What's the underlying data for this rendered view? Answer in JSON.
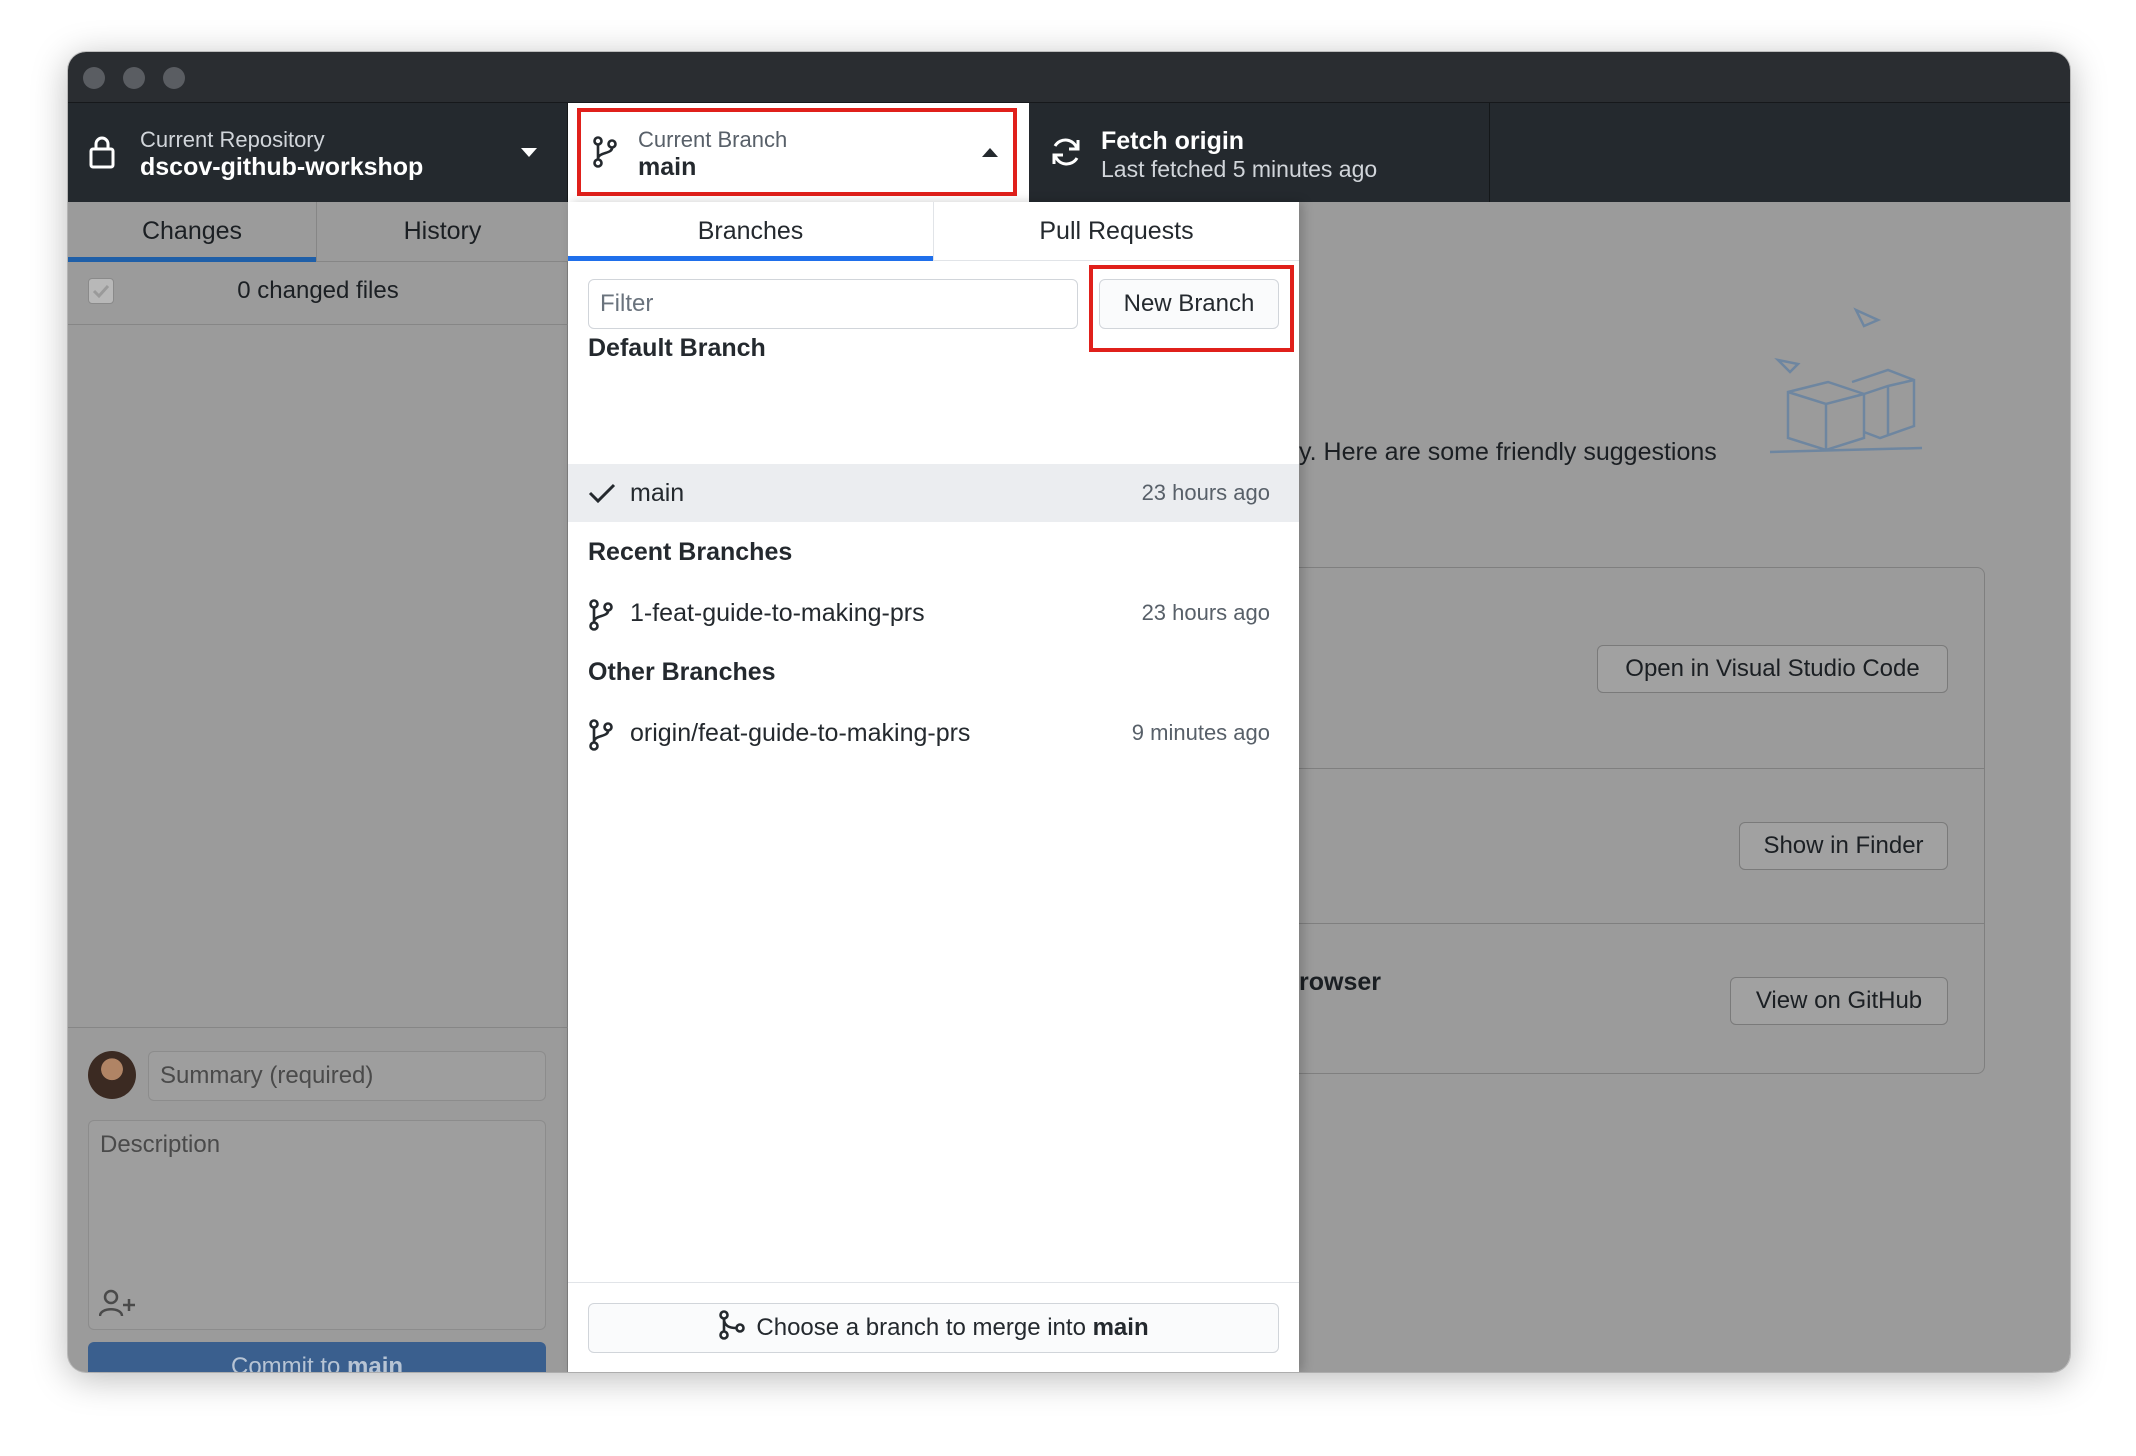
{
  "toolbar": {
    "repo_label": "Current Repository",
    "repo_name": "dscov-github-workshop",
    "branch_label": "Current Branch",
    "branch_name": "main",
    "fetch_title": "Fetch origin",
    "fetch_subtitle": "Last fetched 5 minutes ago"
  },
  "sidebar": {
    "tabs": [
      {
        "label": "Changes",
        "selected": true
      },
      {
        "label": "History",
        "selected": false
      }
    ],
    "changed_files": "0 changed files",
    "summary_placeholder": "Summary (required)",
    "description_placeholder": "Description",
    "commit_prefix": "Commit to ",
    "commit_branch": "main"
  },
  "branch_dropdown": {
    "tabs": [
      {
        "label": "Branches",
        "selected": true
      },
      {
        "label": "Pull Requests",
        "selected": false
      }
    ],
    "filter_placeholder": "Filter",
    "new_branch_label": "New Branch",
    "groups": [
      {
        "header": "Default Branch",
        "branches": [
          {
            "name": "main",
            "time": "23 hours ago",
            "current": true
          }
        ]
      },
      {
        "header": "Recent Branches",
        "branches": [
          {
            "name": "1-feat-guide-to-making-prs",
            "time": "23 hours ago",
            "current": false
          }
        ]
      },
      {
        "header": "Other Branches",
        "branches": [
          {
            "name": "origin/feat-guide-to-making-prs",
            "time": "9 minutes ago",
            "current": false
          }
        ]
      }
    ],
    "merge_prefix": "Choose a branch to merge into ",
    "merge_branch": "main"
  },
  "main_content": {
    "suggestion_fragment": "y. Here are some friendly suggestions",
    "browser_fragment": "rowser",
    "actions": [
      {
        "label": "Open in Visual Studio Code"
      },
      {
        "label": "Show in Finder"
      },
      {
        "label": "View on GitHub"
      }
    ]
  },
  "colors": {
    "highlight": "#e0201b",
    "accent_blue": "#1f5fa8",
    "toolbar_bg": "#24292e"
  }
}
